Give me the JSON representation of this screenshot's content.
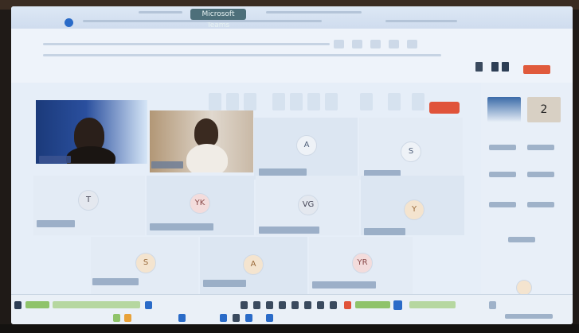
{
  "window": {
    "title": "Microsoft Teams"
  },
  "participants": [
    {
      "initials": "A"
    },
    {
      "initials": "S"
    },
    {
      "initials": "T"
    },
    {
      "initials": "YK"
    },
    {
      "initials": "VG"
    },
    {
      "initials": "Y"
    },
    {
      "initials": "S"
    },
    {
      "initials": "A"
    },
    {
      "initials": "YR"
    }
  ],
  "side_panel": {
    "badge": "2"
  },
  "colors": {
    "accent": "#2a6bc8",
    "leave": "#e0533a",
    "taskbar_green": "#8fc36a"
  }
}
